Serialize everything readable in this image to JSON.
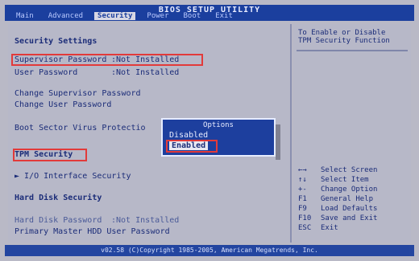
{
  "app": {
    "title": "BIOS SETUP UTILITY",
    "tabs": [
      {
        "label": "Main",
        "active": false
      },
      {
        "label": "Advanced",
        "active": false
      },
      {
        "label": "Security",
        "active": true
      },
      {
        "label": "Power",
        "active": false
      },
      {
        "label": "Boot",
        "active": false
      },
      {
        "label": "Exit",
        "active": false
      }
    ]
  },
  "security": {
    "heading": "Security Settings",
    "supervisor_password_label": "Supervisor Password",
    "supervisor_password_value": ":Not Installed",
    "user_password_label": "User Password",
    "user_password_value": ":Not Installed",
    "change_supervisor_password": "Change Supervisor Password",
    "change_user_password": "Change User Password",
    "boot_sector_virus_protection_label": "Boot Sector Virus Protectio",
    "tpm_security_label": "TPM Security",
    "io_interface_security_label": "► I/O Interface Security",
    "hard_disk_security_heading": "Hard Disk Security",
    "hard_disk_password_label": "Hard Disk Password",
    "hard_disk_password_value": ":Not Installed",
    "primary_master_hdd_user_password_label": "Primary Master HDD User Password"
  },
  "popup": {
    "title": "Options",
    "options": [
      "Disabled",
      "Enabled"
    ],
    "selected": "Enabled"
  },
  "help": {
    "text": "To Enable or Disable\nTPM Security Function"
  },
  "keys": [
    {
      "key": "←→",
      "action": "Select Screen"
    },
    {
      "key": "↑↓",
      "action": "Select Item"
    },
    {
      "key": "+-",
      "action": "Change Option"
    },
    {
      "key": "F1",
      "action": "General Help"
    },
    {
      "key": "F9",
      "action": "Load Defaults"
    },
    {
      "key": "F10",
      "action": "Save and Exit"
    },
    {
      "key": "ESC",
      "action": "Exit"
    }
  ],
  "footer": {
    "text": "v02.58 (C)Copyright 1985-2005, American Megatrends, Inc."
  },
  "colors": {
    "bar_blue": "#1b3f9e",
    "text_blue": "#1b2c78",
    "highlight_red": "#e23a3a"
  }
}
